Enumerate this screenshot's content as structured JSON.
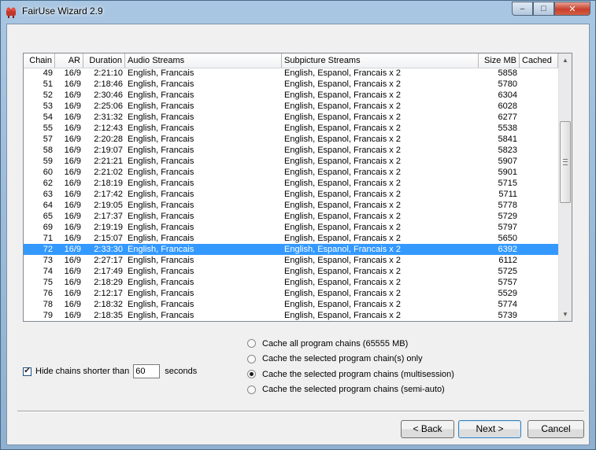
{
  "window": {
    "title": "FairUse Wizard 2.9",
    "caption_min": "–",
    "caption_max": "□",
    "caption_close": "✕"
  },
  "table": {
    "columns": [
      "Chain",
      "AR",
      "Duration",
      "Audio Streams",
      "Subpicture Streams",
      "Size MB",
      "Cached"
    ],
    "rows": [
      [
        "49",
        "16/9",
        "2:21:10",
        "English, Francais",
        "English, Espanol, Francais x 2",
        "5858",
        ""
      ],
      [
        "51",
        "16/9",
        "2:18:46",
        "English, Francais",
        "English, Espanol, Francais x 2",
        "5780",
        ""
      ],
      [
        "52",
        "16/9",
        "2:30:46",
        "English, Francais",
        "English, Espanol, Francais x 2",
        "6304",
        ""
      ],
      [
        "53",
        "16/9",
        "2:25:06",
        "English, Francais",
        "English, Espanol, Francais x 2",
        "6028",
        ""
      ],
      [
        "54",
        "16/9",
        "2:31:32",
        "English, Francais",
        "English, Espanol, Francais x 2",
        "6277",
        ""
      ],
      [
        "55",
        "16/9",
        "2:12:43",
        "English, Francais",
        "English, Espanol, Francais x 2",
        "5538",
        ""
      ],
      [
        "57",
        "16/9",
        "2:20:28",
        "English, Francais",
        "English, Espanol, Francais x 2",
        "5841",
        ""
      ],
      [
        "58",
        "16/9",
        "2:19:07",
        "English, Francais",
        "English, Espanol, Francais x 2",
        "5823",
        ""
      ],
      [
        "59",
        "16/9",
        "2:21:21",
        "English, Francais",
        "English, Espanol, Francais x 2",
        "5907",
        ""
      ],
      [
        "60",
        "16/9",
        "2:21:02",
        "English, Francais",
        "English, Espanol, Francais x 2",
        "5901",
        ""
      ],
      [
        "62",
        "16/9",
        "2:18:19",
        "English, Francais",
        "English, Espanol, Francais x 2",
        "5715",
        ""
      ],
      [
        "63",
        "16/9",
        "2:17:42",
        "English, Francais",
        "English, Espanol, Francais x 2",
        "5711",
        ""
      ],
      [
        "64",
        "16/9",
        "2:19:05",
        "English, Francais",
        "English, Espanol, Francais x 2",
        "5778",
        ""
      ],
      [
        "65",
        "16/9",
        "2:17:37",
        "English, Francais",
        "English, Espanol, Francais x 2",
        "5729",
        ""
      ],
      [
        "69",
        "16/9",
        "2:19:19",
        "English, Francais",
        "English, Espanol, Francais x 2",
        "5797",
        ""
      ],
      [
        "71",
        "16/9",
        "2:15:07",
        "English, Francais",
        "English, Espanol, Francais x 2",
        "5650",
        ""
      ],
      [
        "72",
        "16/9",
        "2:33:30",
        "English, Francais",
        "English, Espanol, Francais x 2",
        "6392",
        ""
      ],
      [
        "73",
        "16/9",
        "2:27:17",
        "English, Francais",
        "English, Espanol, Francais x 2",
        "6112",
        ""
      ],
      [
        "74",
        "16/9",
        "2:17:49",
        "English, Francais",
        "English, Espanol, Francais x 2",
        "5725",
        ""
      ],
      [
        "75",
        "16/9",
        "2:18:29",
        "English, Francais",
        "English, Espanol, Francais x 2",
        "5757",
        ""
      ],
      [
        "76",
        "16/9",
        "2:12:17",
        "English, Francais",
        "English, Espanol, Francais x 2",
        "5529",
        ""
      ],
      [
        "78",
        "16/9",
        "2:18:32",
        "English, Francais",
        "English, Espanol, Francais x 2",
        "5774",
        ""
      ],
      [
        "79",
        "16/9",
        "2:18:35",
        "English, Francais",
        "English, Espanol, Francais x 2",
        "5739",
        ""
      ]
    ],
    "selected_chain": "72"
  },
  "options": {
    "hide_label": "Hide chains shorter than",
    "hide_checked": true,
    "hide_value": "60",
    "seconds_label": "seconds",
    "cache_options": [
      {
        "label": "Cache all program chains (65555 MB)",
        "checked": false
      },
      {
        "label": "Cache the selected program chain(s) only",
        "checked": false
      },
      {
        "label": "Cache the selected program chains (multisession)",
        "checked": true
      },
      {
        "label": "Cache the selected program chains (semi-auto)",
        "checked": false
      }
    ]
  },
  "buttons": {
    "back": "< Back",
    "next": "Next >",
    "cancel": "Cancel"
  },
  "colors": {
    "selection": "#3399ff",
    "close_button": "#c7402c"
  },
  "icons": {
    "app": "fairuse-app-icon",
    "scroll_up": "chevron-up-icon",
    "scroll_down": "chevron-down-icon"
  }
}
